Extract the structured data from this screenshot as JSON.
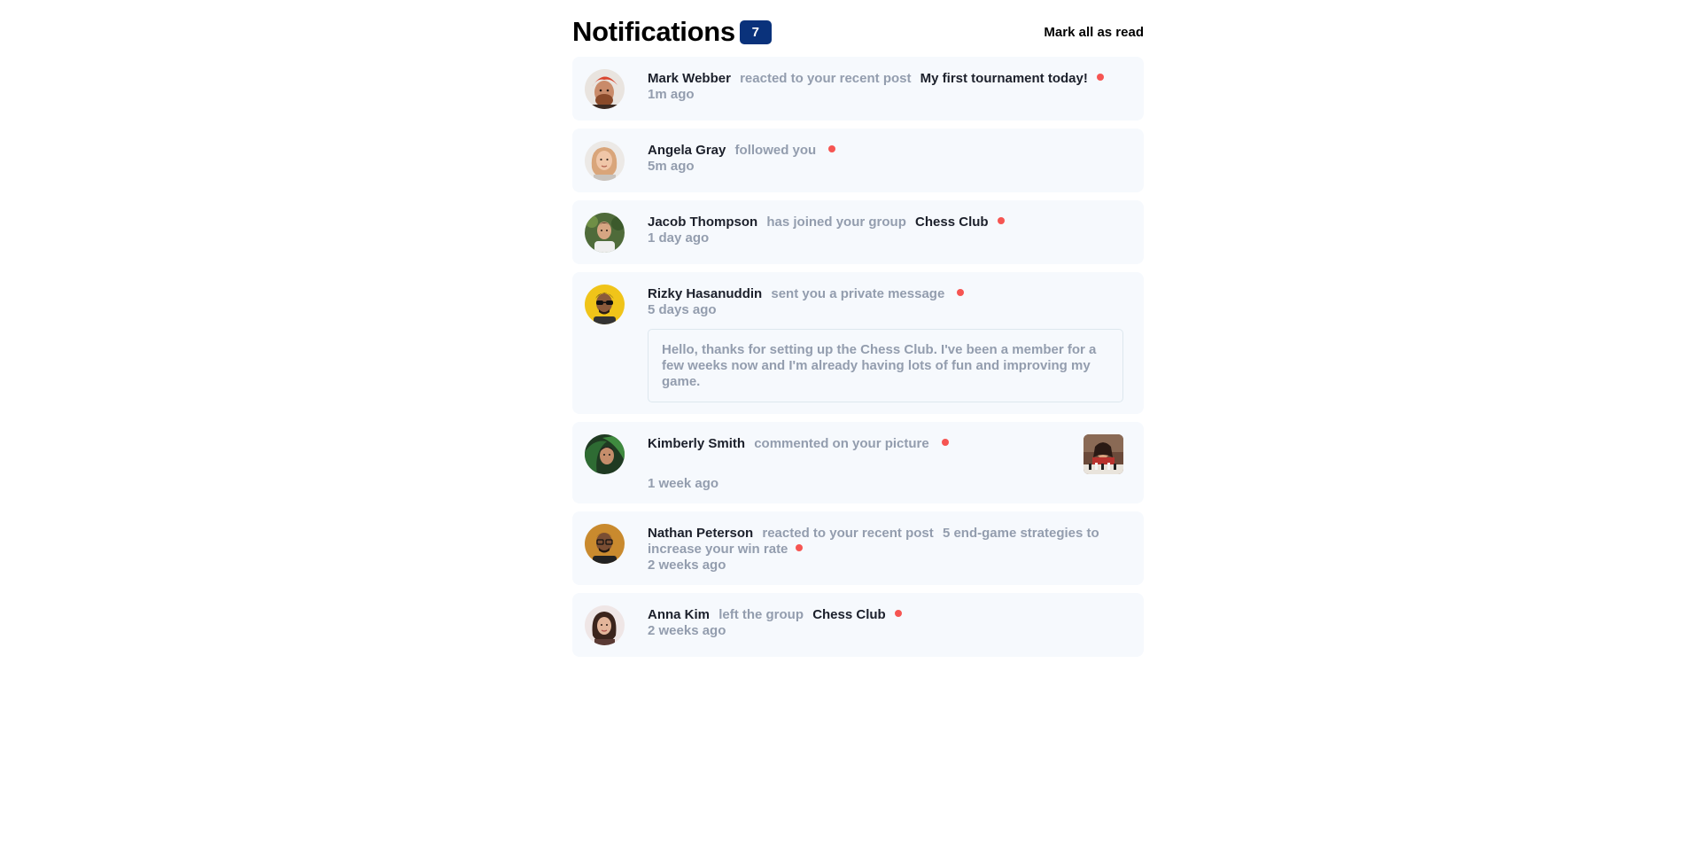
{
  "header": {
    "title": "Notifications",
    "count": "7",
    "mark_all": "Mark all as read"
  },
  "colors": {
    "badge": "#0a327b",
    "unread_dot": "#f65552",
    "card_bg": "#f6f9fd",
    "muted_text": "#939dae"
  },
  "notifications": [
    {
      "name": "Mark Webber",
      "action": "reacted to your recent post",
      "target": "My first tournament today!",
      "time": "1m ago",
      "unread": true,
      "avatar_icon": "avatar-mark-webber"
    },
    {
      "name": "Angela Gray",
      "action": "followed you",
      "time": "5m ago",
      "unread": true,
      "avatar_icon": "avatar-angela-gray"
    },
    {
      "name": "Jacob Thompson",
      "action": "has joined your group",
      "target": "Chess Club",
      "time": "1 day ago",
      "unread": true,
      "avatar_icon": "avatar-jacob-thompson"
    },
    {
      "name": "Rizky Hasanuddin",
      "action": "sent you a private message",
      "time": "5 days ago",
      "message": "Hello, thanks for setting up the Chess Club. I've been a member for a few weeks now and I'm already having lots of fun and improving my game.",
      "unread": true,
      "avatar_icon": "avatar-rizky-hasanuddin"
    },
    {
      "name": "Kimberly Smith",
      "action": "commented on your picture",
      "time": "1 week ago",
      "unread": true,
      "avatar_icon": "avatar-kimberly-smith",
      "picture_icon": "chess-picture-thumbnail"
    },
    {
      "name": "Nathan Peterson",
      "action": "reacted to your recent post",
      "target": "5 end-game strategies to increase your win rate",
      "time": "2 weeks ago",
      "unread": true,
      "avatar_icon": "avatar-nathan-peterson"
    },
    {
      "name": "Anna Kim",
      "action": "left the group",
      "target": "Chess Club",
      "time": "2 weeks ago",
      "unread": true,
      "avatar_icon": "avatar-anna-kim"
    }
  ]
}
